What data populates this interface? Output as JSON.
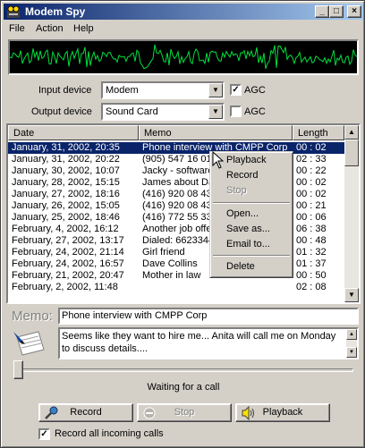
{
  "window": {
    "title": "Modem Spy"
  },
  "menu": [
    "File",
    "Action",
    "Help"
  ],
  "devices": {
    "input_label": "Input device",
    "input_value": "Modem",
    "input_agc_label": "AGC",
    "input_agc_checked": true,
    "output_label": "Output device",
    "output_value": "Sound Card",
    "output_agc_label": "AGC",
    "output_agc_checked": false
  },
  "list": {
    "columns": [
      "Date",
      "Memo",
      "Length"
    ],
    "rows": [
      {
        "date": "January, 31, 2002, 20:35",
        "memo": "Phone interview with CMPP Corp",
        "length": "00 : 02",
        "selected": true
      },
      {
        "date": "January, 31, 2002, 20:22",
        "memo": "(905) 547 16 01",
        "length": "02 : 33"
      },
      {
        "date": "January, 30, 2002, 10:07",
        "memo": "Jacky - software",
        "length": "00 : 22"
      },
      {
        "date": "January, 28, 2002, 15:15",
        "memo": "James about Da",
        "length": "00 : 02"
      },
      {
        "date": "January, 27, 2002, 18:16",
        "memo": "(416) 920 08 43",
        "length": "00 : 02"
      },
      {
        "date": "January, 26, 2002, 15:05",
        "memo": "(416) 920 08 43",
        "length": "00 : 21"
      },
      {
        "date": "January, 25, 2002, 18:46",
        "memo": "(416) 772 55 33",
        "length": "00 : 06"
      },
      {
        "date": "February, 4, 2002, 16:12",
        "memo": "Another job offe",
        "length": "06 : 38"
      },
      {
        "date": "February, 27, 2002, 13:17",
        "memo": "Dialed: 6623344",
        "length": "00 : 48"
      },
      {
        "date": "February, 24, 2002, 21:14",
        "memo": "Girl friend",
        "length": "01 : 32"
      },
      {
        "date": "February, 24, 2002, 16:57",
        "memo": "Dave Collins",
        "length": "01 : 37"
      },
      {
        "date": "February, 21, 2002, 20:47",
        "memo": "Mother in law",
        "length": "00 : 50"
      },
      {
        "date": "February, 2, 2002, 11:48",
        "memo": "",
        "length": "02 : 08"
      }
    ]
  },
  "context_menu": {
    "items": [
      {
        "label": "Playback",
        "disabled": false
      },
      {
        "label": "Record",
        "disabled": false
      },
      {
        "label": "Stop",
        "disabled": true
      },
      {
        "label": "Open...",
        "disabled": false
      },
      {
        "label": "Save as...",
        "disabled": false
      },
      {
        "label": "Email to...",
        "disabled": false
      },
      {
        "label": "Delete",
        "disabled": false
      }
    ]
  },
  "memo": {
    "label": "Memo:",
    "title": "Phone interview with CMPP Corp",
    "text": "Seems like they want to hire me... Anita will call me on Monday to discuss details...."
  },
  "playback_position": 0,
  "status": "Waiting for a call",
  "buttons": {
    "record": "Record",
    "stop": "Stop",
    "playback": "Playback"
  },
  "record_all": {
    "label": "Record all incoming calls",
    "checked": true
  },
  "colors": {
    "face": "#d4d0c8",
    "selection": "#0a246a",
    "waveform": "#00e040",
    "title_start": "#0a246a",
    "title_end": "#a6caf0"
  }
}
